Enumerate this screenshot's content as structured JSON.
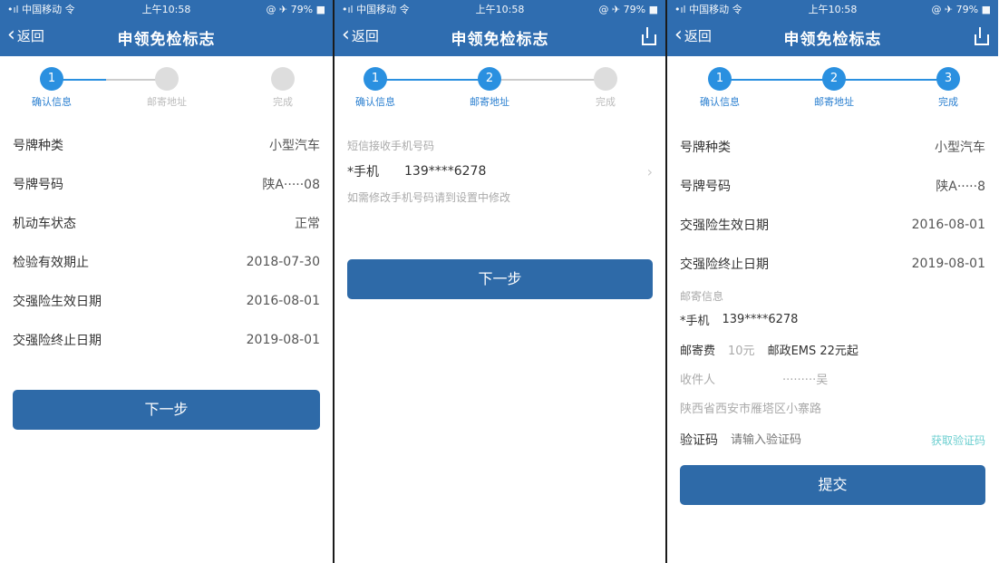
{
  "status_bar": {
    "carrier": "•ıl 中国移动 令",
    "time": "上午10:58",
    "right": "@ ✈ 79% ■"
  },
  "nav": {
    "back_label": "返回",
    "title": "申领免检标志"
  },
  "steps": [
    {
      "number": "1",
      "label": "确认信息"
    },
    {
      "number": "2",
      "label": "邮寄地址"
    },
    {
      "number": "3",
      "label": "完成"
    }
  ],
  "screen1": {
    "rows": [
      {
        "label": "号牌种类",
        "value": "小型汽车"
      },
      {
        "label": "号牌号码",
        "value": "陕A·····08"
      },
      {
        "label": "机动车状态",
        "value": "正常"
      },
      {
        "label": "检验有效期止",
        "value": "2018-07-30"
      },
      {
        "label": "交强险生效日期",
        "value": "2016-08-01"
      },
      {
        "label": "交强险终止日期",
        "value": "2019-08-01"
      }
    ],
    "next_label": "下一步"
  },
  "screen2": {
    "section_title": "短信接收手机号码",
    "phone_label": "*手机",
    "phone_value": "139****6278",
    "hint": "如需修改手机号码请到设置中修改",
    "next_label": "下一步"
  },
  "screen3": {
    "rows": [
      {
        "label": "号牌种类",
        "value": "小型汽车"
      },
      {
        "label": "号牌号码",
        "value": "陕A·····8"
      },
      {
        "label": "交强险生效日期",
        "value": "2016-08-01"
      },
      {
        "label": "交强险终止日期",
        "value": "2019-08-01"
      }
    ],
    "section_title": "邮寄信息",
    "phone_label": "*手机",
    "phone_value": "139****6278",
    "fee_label": "邮寄费",
    "fee_value": "10元",
    "fee_note": "邮政EMS 22元起",
    "recipient_label": "收件人",
    "recipient_value": "·········吴",
    "address": "陕西省西安市雁塔区小寨路",
    "verify_label": "验证码",
    "verify_placeholder": "请输入验证码",
    "verify_button": "获取验证码",
    "submit_label": "提交"
  }
}
